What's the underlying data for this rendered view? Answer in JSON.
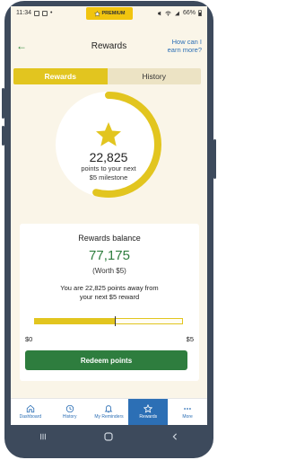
{
  "status_bar": {
    "time": "11:34",
    "battery": "66%",
    "premium_label": "PREMIUM"
  },
  "header": {
    "title": "Rewards",
    "help_link": "How can I earn more?"
  },
  "tabs": [
    {
      "label": "Rewards",
      "active": true
    },
    {
      "label": "History",
      "active": false
    }
  ],
  "progress_ring": {
    "points": "22,825",
    "subtitle_line1": "points to your next",
    "subtitle_line2": "$5 milestone",
    "progress_fraction": 0.54
  },
  "balance_card": {
    "title": "Rewards balance",
    "balance": "77,175",
    "worth": "(Worth $5)",
    "message_line1": "You are 22,825 points away from",
    "message_line2": "your next $5 reward",
    "progress_fraction": 0.54,
    "min_label": "$0",
    "max_label": "$5",
    "button_label": "Redeem points"
  },
  "bottom_nav": [
    {
      "label": "Dashboard",
      "icon": "home-icon"
    },
    {
      "label": "History",
      "icon": "clock-icon"
    },
    {
      "label": "My Reminders",
      "icon": "bell-icon"
    },
    {
      "label": "Rewards",
      "icon": "star-icon",
      "active": true
    },
    {
      "label": "More",
      "icon": "more-dots-icon"
    }
  ],
  "colors": {
    "accent_yellow": "#e2c51f",
    "brand_green": "#2e7d3e",
    "link_blue": "#2c6fb5",
    "background": "#faf5e8"
  }
}
